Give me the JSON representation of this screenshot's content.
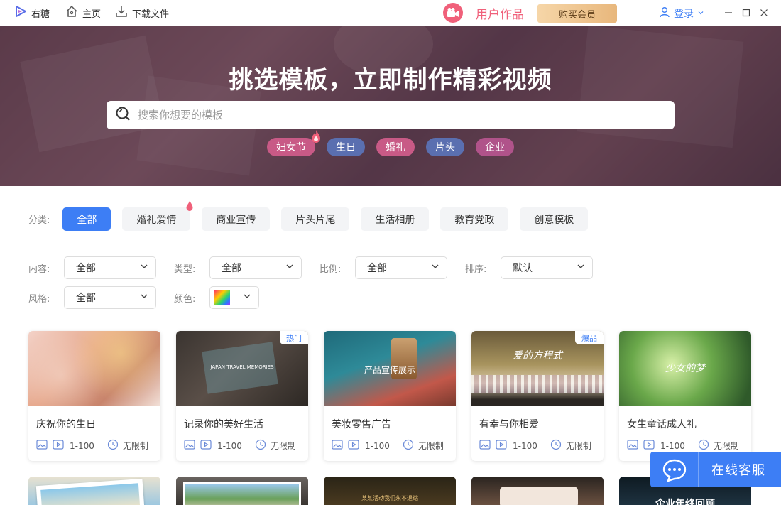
{
  "app": {
    "name": "右糖"
  },
  "nav": {
    "home": "主页",
    "downloads": "下载文件"
  },
  "header": {
    "works_label": "用户作品",
    "vip_button": "购买会员",
    "login": "登录"
  },
  "hero": {
    "title": "挑选模板，立即制作精彩视频",
    "search_placeholder": "搜索你想要的模板",
    "hot_tags": [
      {
        "label": "妇女节",
        "color": "#c85a86"
      },
      {
        "label": "生日",
        "color": "#5a6fb0"
      },
      {
        "label": "婚礼",
        "color": "#c85a86"
      },
      {
        "label": "片头",
        "color": "#5a6fb0"
      },
      {
        "label": "企业",
        "color": "#b0538a"
      }
    ]
  },
  "filters": {
    "category_label": "分类:",
    "categories": [
      "全部",
      "婚礼爱情",
      "商业宣传",
      "片头片尾",
      "生活相册",
      "教育党政",
      "创意模板"
    ],
    "content_label": "内容:",
    "content_value": "全部",
    "type_label": "类型:",
    "type_value": "全部",
    "ratio_label": "比例:",
    "ratio_value": "全部",
    "sort_label": "排序:",
    "sort_value": "默认",
    "style_label": "风格:",
    "style_value": "全部",
    "color_label": "颜色:"
  },
  "cards": [
    {
      "title": "庆祝你的生日",
      "count": "1-100",
      "duration": "无限制",
      "badge": "",
      "overlay": ""
    },
    {
      "title": "记录你的美好生活",
      "count": "1-100",
      "duration": "无限制",
      "badge": "热门",
      "overlay": "JAPAN TRAVEL MEMORIES"
    },
    {
      "title": "美妆零售广告",
      "count": "1-100",
      "duration": "无限制",
      "badge": "",
      "overlay": "产品宣传展示"
    },
    {
      "title": "有幸与你相爱",
      "count": "1-100",
      "duration": "无限制",
      "badge": "爆品",
      "overlay": "爱的方程式"
    },
    {
      "title": "女生童话成人礼",
      "count": "1-100",
      "duration": "无限制",
      "badge": "",
      "overlay": "少女的梦"
    }
  ],
  "row2_overlays": [
    "",
    "",
    "某某活动我们永不退缩",
    "",
    "企业年终回顾"
  ],
  "support": {
    "label": "在线客服"
  },
  "colors": {
    "accent": "#3d7ef5",
    "hot": "#f0607a"
  }
}
